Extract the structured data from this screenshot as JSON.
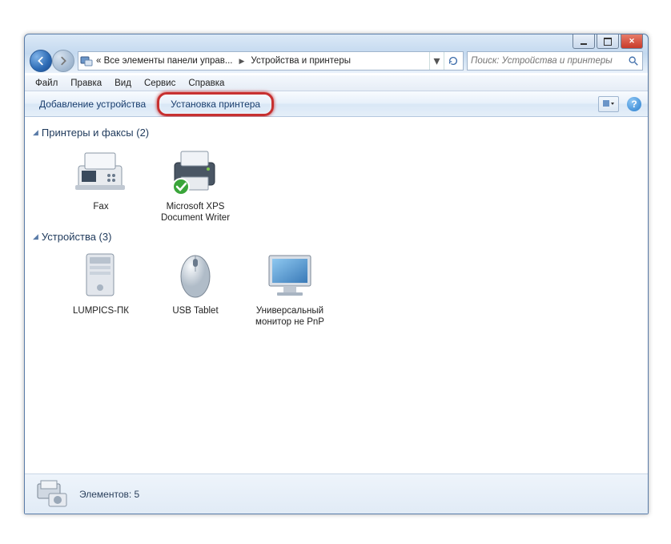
{
  "breadcrumb": {
    "seg1": "« Все элементы панели управ...",
    "seg2": "Устройства и принтеры"
  },
  "search": {
    "placeholder": "Поиск: Устройства и принтеры"
  },
  "menu": {
    "file": "Файл",
    "edit": "Правка",
    "view": "Вид",
    "service": "Сервис",
    "help": "Справка"
  },
  "toolbar": {
    "add_device": "Добавление устройства",
    "add_printer": "Установка принтера"
  },
  "groups": {
    "printers": {
      "title": "Принтеры и факсы (2)",
      "items": [
        {
          "label": "Fax"
        },
        {
          "label": "Microsoft XPS Document Writer"
        }
      ]
    },
    "devices": {
      "title": "Устройства (3)",
      "items": [
        {
          "label": "LUMPICS-ПК"
        },
        {
          "label": "USB Tablet"
        },
        {
          "label": "Универсальный монитор не PnP"
        }
      ]
    }
  },
  "status": {
    "text": "Элементов: 5"
  }
}
